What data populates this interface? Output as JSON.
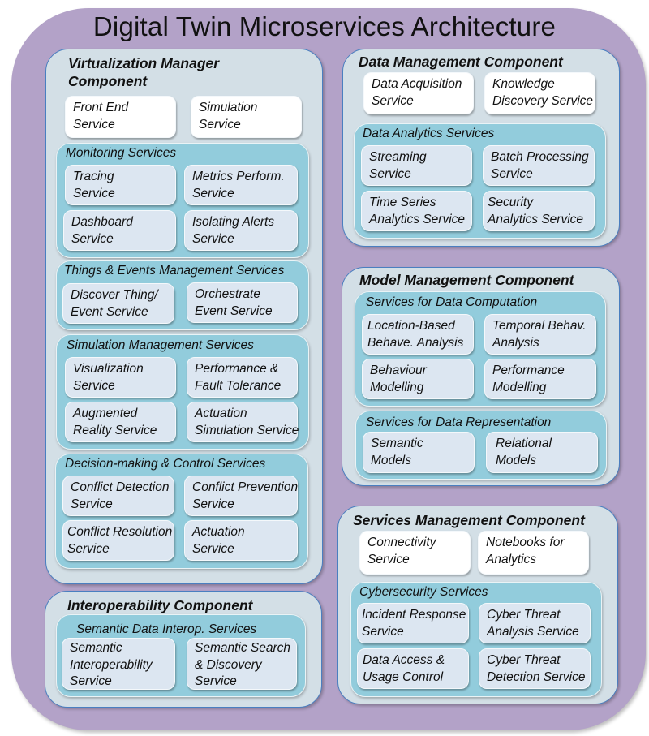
{
  "title": "Digital Twin Microservices Architecture",
  "colors": {
    "background": "#b3a2c8",
    "component_fill": "#d3dfe6",
    "component_border": "#4a7fc0",
    "group_fill": "#92ccdc",
    "service_fill": "#dce6f1",
    "top_service_fill": "#ffffff"
  },
  "components": {
    "virtualization": {
      "title": "Virtualization Manager\nComponent",
      "top_services": [
        "Front End\nService",
        "Simulation\nService"
      ],
      "groups": [
        {
          "title": "Monitoring Services",
          "services": [
            "Tracing\nService",
            "Metrics Perform.\nService",
            "Dashboard\nService",
            "Isolating Alerts\nService"
          ]
        },
        {
          "title": "Things & Events Management Services",
          "services": [
            "Discover Thing/\nEvent Service",
            "Orchestrate\nEvent Service"
          ]
        },
        {
          "title": "Simulation Management Services",
          "services": [
            "Visualization\nService",
            "Performance &\nFault Tolerance",
            "Augmented\nReality Service",
            "Actuation\nSimulation Service"
          ]
        },
        {
          "title": "Decision-making & Control Services",
          "services": [
            "Conflict Detection\nService",
            "Conflict Prevention\nService",
            "Conflict Resolution\nService",
            "Actuation\nService"
          ]
        }
      ]
    },
    "interoperability": {
      "title": "Interoperability Component",
      "groups": [
        {
          "title": "Semantic Data Interop. Services",
          "services": [
            "Semantic\nInteroperability\nService",
            "Semantic Search\n& Discovery\nService"
          ]
        }
      ]
    },
    "data_management": {
      "title": "Data Management Component",
      "top_services": [
        "Data Acquisition\nService",
        "Knowledge\nDiscovery Service"
      ],
      "groups": [
        {
          "title": "Data Analytics Services",
          "services": [
            "Streaming\nService",
            "Batch Processing\nService",
            "Time Series\nAnalytics Service",
            "Security\nAnalytics Service"
          ]
        }
      ]
    },
    "model_management": {
      "title": "Model Management Component",
      "groups": [
        {
          "title": "Services for Data Computation",
          "services": [
            "Location-Based\nBehave. Analysis",
            "Temporal Behav.\nAnalysis",
            "Behaviour\nModelling",
            "Performance\nModelling"
          ]
        },
        {
          "title": "Services for Data Representation",
          "services": [
            "Semantic\nModels",
            "Relational\nModels"
          ]
        }
      ]
    },
    "services_management": {
      "title": "Services Management Component",
      "top_services": [
        "Connectivity\nService",
        "Notebooks for\nAnalytics"
      ],
      "groups": [
        {
          "title": "Cybersecurity Services",
          "services": [
            "Incident Response\nService",
            "Cyber Threat\nAnalysis Service",
            "Data Access &\nUsage Control",
            "Cyber Threat\nDetection Service"
          ]
        }
      ]
    }
  }
}
